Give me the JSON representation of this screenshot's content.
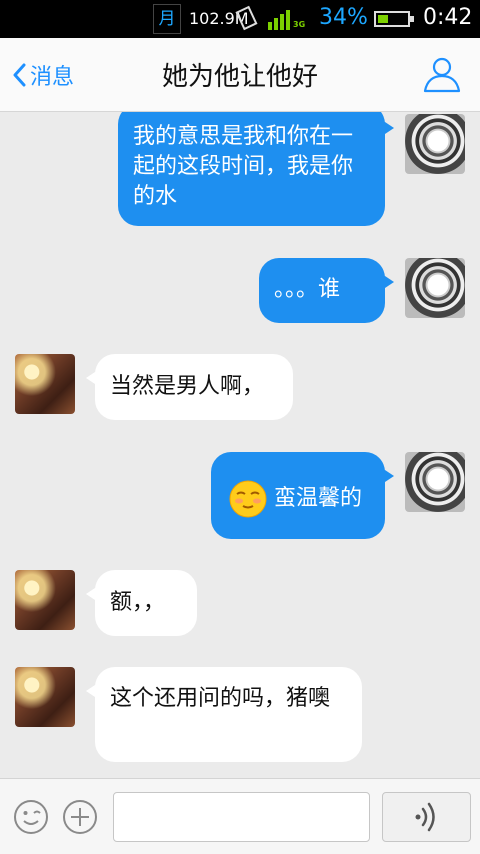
{
  "status_bar": {
    "moon_glyph": "月",
    "net_speed": "102.9M",
    "network": "3G",
    "battery_pct": "34%",
    "battery_level": 0.34,
    "time": "0:42"
  },
  "nav": {
    "back_label": "消息",
    "title": "她为他让他好"
  },
  "messages": [
    {
      "side": "out",
      "text": "我的意思是我和你在一起的这段时间，我是你的水"
    },
    {
      "side": "out",
      "text": "。。。谁"
    },
    {
      "side": "in",
      "text": "当然是男人啊，"
    },
    {
      "side": "out",
      "text": "蛮温馨的",
      "emoji": "smile-emoji"
    },
    {
      "side": "in",
      "text": "额，，"
    },
    {
      "side": "in",
      "text": "这个还用问的吗，猪噢"
    }
  ],
  "input": {
    "value": "",
    "placeholder": ""
  },
  "colors": {
    "accent": "#1e8ff0",
    "chat_bg": "#ebebeb"
  }
}
